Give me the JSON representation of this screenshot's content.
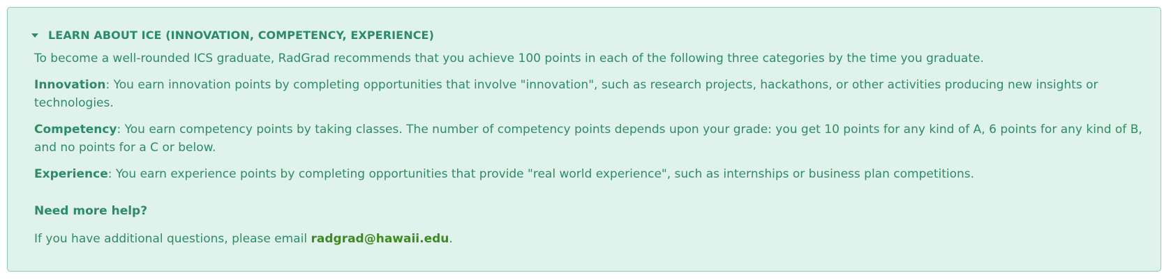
{
  "accordion": {
    "title": "LEARN ABOUT ICE (INNOVATION, COMPETENCY, EXPERIENCE)",
    "expanded": true,
    "caret_icon": "caret-down-icon",
    "intro": "To become a well-rounded ICS graduate, RadGrad recommends that you achieve 100 points in each of the following three categories by the time you graduate.",
    "categories": [
      {
        "term": "Innovation",
        "description": ": You earn innovation points by completing opportunities that involve \"innovation\", such as research projects, hackathons, or other activities producing new insights or technologies."
      },
      {
        "term": "Competency",
        "description": ": You earn competency points by taking classes. The number of competency points depends upon your grade: you get 10 points for any kind of A, 6 points for any kind of B, and no points for a C or below."
      },
      {
        "term": "Experience",
        "description": ": You earn experience points by completing opportunities that provide \"real world experience\", such as internships or business plan competitions."
      }
    ],
    "help": {
      "title": "Need more help?",
      "text_before": "If you have additional questions, please email ",
      "email": "radgrad@hawaii.edu",
      "text_after": "."
    }
  },
  "colors": {
    "panel_bg": "#e0f2ec",
    "panel_border": "#8ec9b2",
    "text": "#2c8c67",
    "link": "#3c8b1f"
  }
}
